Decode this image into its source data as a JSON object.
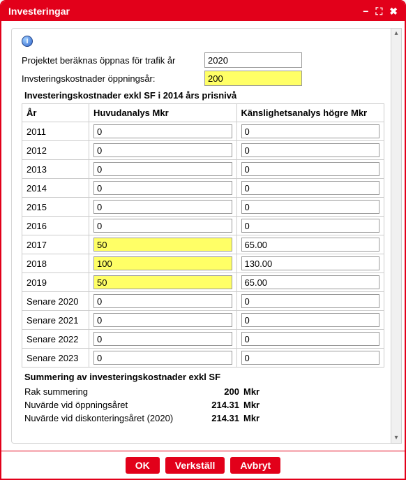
{
  "window": {
    "title": "Investeringar"
  },
  "form": {
    "traffic_year_label": "Projektet beräknas öppnas för trafik år",
    "traffic_year_value": "2020",
    "cost_open_label": "Invsteringskostnader öppningsår:",
    "cost_open_value": "200"
  },
  "table": {
    "title": "Investeringskostnader exkl SF i 2014 års prisnivå",
    "col_year": "År",
    "col_main": "Huvudanalys Mkr",
    "col_sens": "Känslighetsanalys högre Mkr",
    "rows": [
      {
        "year": "2011",
        "main": "0",
        "main_hl": false,
        "sens": "0"
      },
      {
        "year": "2012",
        "main": "0",
        "main_hl": false,
        "sens": "0"
      },
      {
        "year": "2013",
        "main": "0",
        "main_hl": false,
        "sens": "0"
      },
      {
        "year": "2014",
        "main": "0",
        "main_hl": false,
        "sens": "0"
      },
      {
        "year": "2015",
        "main": "0",
        "main_hl": false,
        "sens": "0"
      },
      {
        "year": "2016",
        "main": "0",
        "main_hl": false,
        "sens": "0"
      },
      {
        "year": "2017",
        "main": "50",
        "main_hl": true,
        "sens": "65.00"
      },
      {
        "year": "2018",
        "main": "100",
        "main_hl": true,
        "sens": "130.00"
      },
      {
        "year": "2019",
        "main": "50",
        "main_hl": true,
        "sens": "65.00"
      },
      {
        "year": "Senare 2020",
        "main": "0",
        "main_hl": false,
        "sens": "0"
      },
      {
        "year": "Senare 2021",
        "main": "0",
        "main_hl": false,
        "sens": "0"
      },
      {
        "year": "Senare 2022",
        "main": "0",
        "main_hl": false,
        "sens": "0"
      },
      {
        "year": "Senare 2023",
        "main": "0",
        "main_hl": false,
        "sens": "0"
      }
    ]
  },
  "summary": {
    "title": "Summering av investeringskostnader exkl SF",
    "rows": [
      {
        "label": "Rak summering",
        "value": "200",
        "unit": "Mkr"
      },
      {
        "label": "Nuvärde vid öppningsåret",
        "value": "214.31",
        "unit": "Mkr"
      },
      {
        "label": "Nuvärde vid diskonteringsåret (2020)",
        "value": "214.31",
        "unit": "Mkr"
      }
    ]
  },
  "footer": {
    "ok": "OK",
    "apply": "Verkställ",
    "cancel": "Avbryt"
  }
}
